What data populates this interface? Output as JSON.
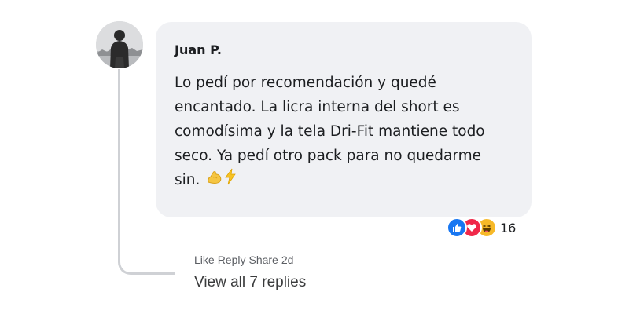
{
  "comment": {
    "author": "Juan P.",
    "text": "Lo pedí por recomendación y quedé encantado. La licra interna del short es comodísima y la tela Dri-Fit mantiene todo seco. Ya pedí otro pack para no quedarme sin.",
    "emojis": [
      "flexed-biceps",
      "high-voltage"
    ]
  },
  "reactions": {
    "types": [
      "like",
      "love",
      "haha"
    ],
    "count": "16"
  },
  "actions": {
    "like": "Like",
    "reply": "Reply",
    "share": "Share",
    "time": "2d"
  },
  "replies": {
    "label": "View all 7 replies"
  },
  "colors": {
    "bubble": "#f0f1f4",
    "like": "#1877f2",
    "love": "#f02849",
    "haha": "#f7b928",
    "thread_line": "#cfd1d5"
  }
}
